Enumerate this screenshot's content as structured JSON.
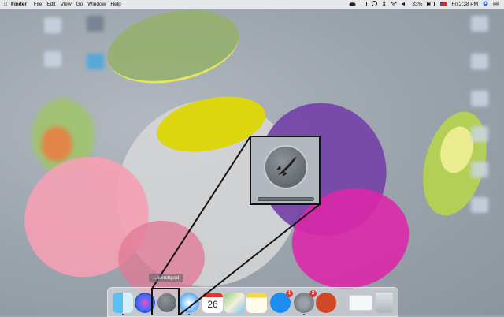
{
  "menubar": {
    "apple_icon": "apple-icon",
    "app_name": "Finder",
    "items": [
      "File",
      "Edit",
      "View",
      "Go",
      "Window",
      "Help"
    ],
    "status": {
      "battery_percent": "33%",
      "clock": "Fri 2:38 PM"
    }
  },
  "tooltip": {
    "label": "Launchpad"
  },
  "dock": {
    "apps": [
      {
        "name": "Finder",
        "icon": "finder-icon",
        "running": true
      },
      {
        "name": "Siri",
        "icon": "siri-icon",
        "running": false
      },
      {
        "name": "Launchpad",
        "icon": "launchpad-rocket-icon",
        "running": false
      },
      {
        "name": "Safari",
        "icon": "safari-compass-icon",
        "running": true
      },
      {
        "name": "Calendar",
        "icon": "calendar-icon",
        "running": false,
        "date": "26"
      },
      {
        "name": "Maps",
        "icon": "maps-icon",
        "running": false
      },
      {
        "name": "Notes",
        "icon": "notes-icon",
        "running": false
      },
      {
        "name": "App Store",
        "icon": "app-store-icon",
        "running": false,
        "badge": "1"
      },
      {
        "name": "System Preferences",
        "icon": "system-preferences-icon",
        "running": true,
        "badge": "2"
      },
      {
        "name": "PowerPoint",
        "icon": "powerpoint-icon",
        "running": false
      },
      {
        "name": "Downloads",
        "icon": "downloads-folder-icon",
        "running": false
      },
      {
        "name": "Trash",
        "icon": "trash-icon",
        "running": false
      }
    ]
  },
  "zoom": {
    "icon": "launchpad-rocket-icon"
  },
  "colors": {
    "accent": "#e2362e",
    "menubar": "#eceef0"
  }
}
